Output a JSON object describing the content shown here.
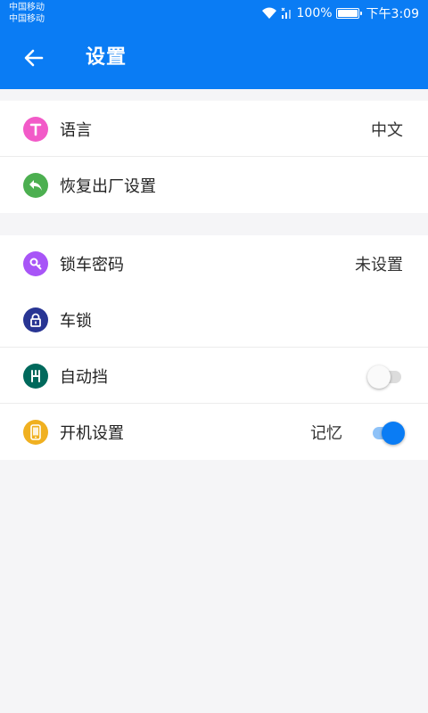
{
  "status_bar": {
    "carrier_1": "中国移动",
    "carrier_2": "中国移动",
    "battery": "100%",
    "time": "下午3:09",
    "icons": [
      "wifi-icon",
      "signal-icon",
      "battery-icon"
    ]
  },
  "app_bar": {
    "title": "设置",
    "back_icon": "arrow-left-icon",
    "background": "#0a7cf4"
  },
  "group1": {
    "items": [
      {
        "label": "语言",
        "value": "中文",
        "icon": "text-t-icon",
        "icon_color": "#f25ac8"
      },
      {
        "label": "恢复出厂设置",
        "value": "",
        "icon": "reply-arrow-icon",
        "icon_color": "#4caf50"
      }
    ]
  },
  "group2": {
    "items": [
      {
        "label": "锁车密码",
        "value": "未设置",
        "icon": "key-icon",
        "icon_color": "#a855f7"
      },
      {
        "label": "车锁",
        "value": "",
        "icon": "padlock-icon",
        "icon_color": "#283593"
      },
      {
        "label": "自动挡",
        "value": "",
        "icon": "gear-shift-icon",
        "icon_color": "#00695c",
        "toggle_on": false
      },
      {
        "label": "开机设置",
        "value": "记忆",
        "icon": "phone-icon",
        "icon_color": "#f0b020",
        "toggle_on": true
      }
    ]
  }
}
